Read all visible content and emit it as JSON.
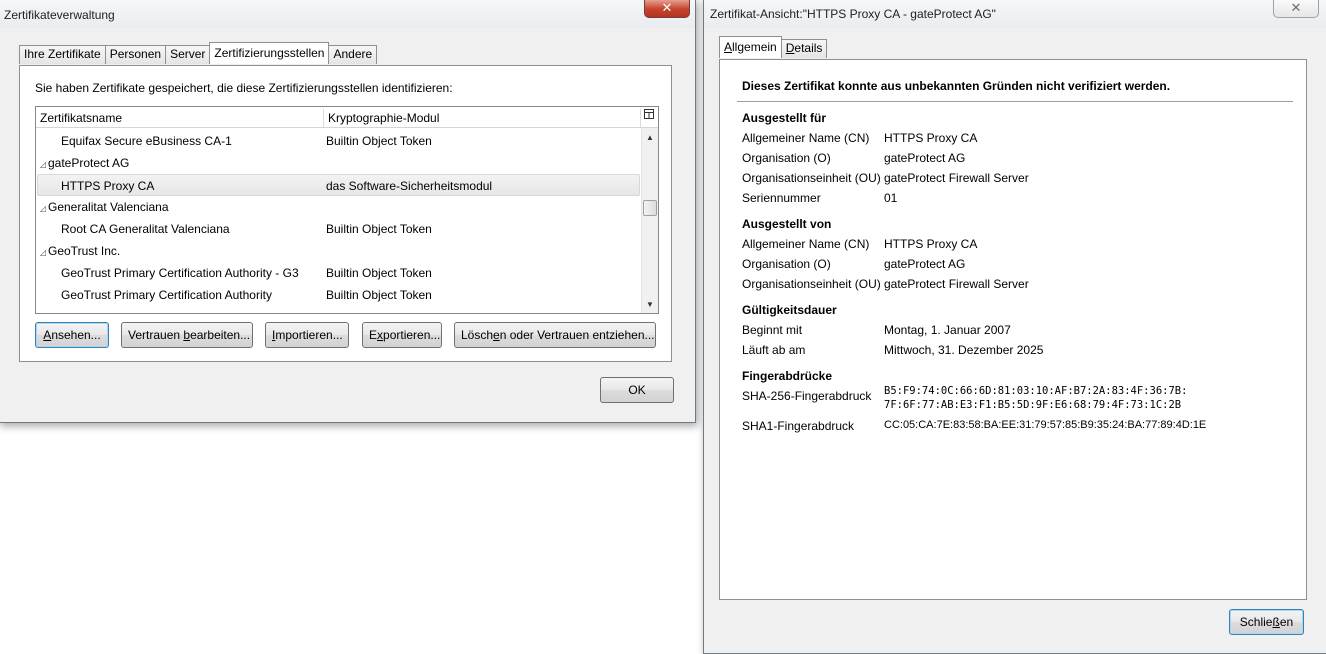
{
  "manager": {
    "title": "Zertifikateverwaltung",
    "tabs": [
      {
        "label": "Ihre Zertifikate"
      },
      {
        "label": "Personen"
      },
      {
        "label": "Server"
      },
      {
        "label": "Zertifizierungsstellen"
      },
      {
        "label": "Andere"
      }
    ],
    "active_tab": "Zertifizierungsstellen",
    "description": "Sie haben Zertifikate gespeichert, die diese Zertifizierungsstellen identifizieren:",
    "columns": {
      "name": "Zertifikatsname",
      "module": "Kryptographie-Modul"
    },
    "rows": [
      {
        "type": "cert",
        "name": "Equifax Secure eBusiness CA-1",
        "module": "Builtin Object Token"
      },
      {
        "type": "group",
        "name": "gateProtect AG",
        "module": ""
      },
      {
        "type": "cert",
        "name": "HTTPS Proxy CA",
        "module": "das Software-Sicherheitsmodul",
        "selected": true
      },
      {
        "type": "group",
        "name": "Generalitat Valenciana",
        "module": ""
      },
      {
        "type": "cert",
        "name": "Root CA Generalitat Valenciana",
        "module": "Builtin Object Token"
      },
      {
        "type": "group",
        "name": "GeoTrust Inc.",
        "module": ""
      },
      {
        "type": "cert",
        "name": "GeoTrust Primary Certification Authority - G3",
        "module": "Builtin Object Token"
      },
      {
        "type": "cert",
        "name": "GeoTrust Primary Certification Authority",
        "module": "Builtin Object Token"
      }
    ],
    "buttons": {
      "view": {
        "pre": "",
        "key": "A",
        "post": "nsehen..."
      },
      "trust": {
        "pre": "Vertrauen ",
        "key": "b",
        "post": "earbeiten..."
      },
      "import": {
        "pre": "",
        "key": "I",
        "post": "mportieren..."
      },
      "export": {
        "pre": "E",
        "key": "x",
        "post": "portieren..."
      },
      "delete": {
        "pre": "Lösch",
        "key": "e",
        "post": "n oder Vertrauen entziehen..."
      },
      "ok": "OK"
    }
  },
  "viewer": {
    "title": "Zertifikat-Ansicht:\"HTTPS Proxy CA - gateProtect AG\"",
    "tabs": [
      {
        "pre": "",
        "key": "A",
        "post": "llgemein"
      },
      {
        "pre": "",
        "key": "D",
        "post": "etails"
      }
    ],
    "warning": "Dieses Zertifikat konnte aus unbekannten Gründen nicht verifiziert werden.",
    "issued_to": {
      "title": "Ausgestellt für",
      "fields": [
        {
          "label": "Allgemeiner Name (CN)",
          "value": "HTTPS Proxy CA"
        },
        {
          "label": "Organisation (O)",
          "value": "gateProtect AG"
        },
        {
          "label": "Organisationseinheit (OU)",
          "value": "gateProtect Firewall Server"
        },
        {
          "label": "Seriennummer",
          "value": "01"
        }
      ]
    },
    "issued_by": {
      "title": "Ausgestellt von",
      "fields": [
        {
          "label": "Allgemeiner Name (CN)",
          "value": "HTTPS Proxy CA"
        },
        {
          "label": "Organisation (O)",
          "value": "gateProtect AG"
        },
        {
          "label": "Organisationseinheit (OU)",
          "value": "gateProtect Firewall Server"
        }
      ]
    },
    "validity": {
      "title": "Gültigkeitsdauer",
      "fields": [
        {
          "label": "Beginnt mit",
          "value": "Montag, 1. Januar 2007"
        },
        {
          "label": "Läuft ab am",
          "value": "Mittwoch, 31. Dezember 2025"
        }
      ]
    },
    "fingerprints": {
      "title": "Fingerabdrücke",
      "sha256_label": "SHA-256-Fingerabdruck",
      "sha256_line1": "B5:F9:74:0C:66:6D:81:03:10:AF:B7:2A:83:4F:36:7B:",
      "sha256_line2": "7F:6F:77:AB:E3:F1:B5:5D:9F:E6:68:79:4F:73:1C:2B",
      "sha1_label": "SHA1-Fingerabdruck",
      "sha1_value": "CC:05:CA:7E:83:58:BA:EE:31:79:57:85:B9:35:24:BA:77:89:4D:1E"
    },
    "close_button": {
      "pre": "Schlie",
      "key": "ß",
      "post": "en"
    }
  }
}
